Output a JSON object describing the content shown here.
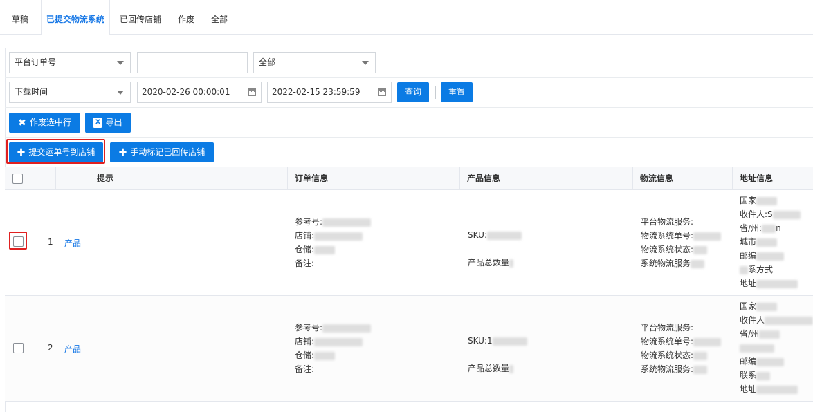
{
  "tabs": [
    {
      "label": "草稿",
      "active": false
    },
    {
      "label": "已提交物流系统",
      "active": true
    },
    {
      "label": "已回传店铺",
      "active": false
    },
    {
      "label": "作废",
      "active": false
    },
    {
      "label": "全部",
      "active": false
    }
  ],
  "filters": {
    "search_field": "平台订单号",
    "search_value": "",
    "status": "全部",
    "time_field": "下载时间",
    "start_time": "2020-02-26 00:00:01",
    "end_time": "2022-02-15 23:59:59",
    "query_label": "查询",
    "reset_label": "重置"
  },
  "actions": {
    "void_selected": "作废选中行",
    "export": "导出",
    "export_icon": "X",
    "submit_tracking": "提交运单号到店铺",
    "mark_returned": "手动标记已回传店铺"
  },
  "columns": [
    "提示",
    "订单信息",
    "产品信息",
    "物流信息",
    "地址信息"
  ],
  "rows": [
    {
      "index": "1",
      "hint": "产品",
      "order": [
        "参考号:",
        "店铺:",
        "仓储:",
        "备注:"
      ],
      "product": [
        "SKU:",
        "产品总数量"
      ],
      "logistics": [
        "平台物流服务:",
        "物流系统单号:",
        "物流系统状态:",
        "系统物流服务"
      ],
      "address": [
        "国家",
        "收件人:S",
        "省/州:",
        "城市",
        "邮编",
        "系方式",
        "地址"
      ],
      "address_tail": {
        "province": "n"
      }
    },
    {
      "index": "2",
      "hint": "产品",
      "order": [
        "参考号:",
        "店铺:",
        "仓储:",
        "备注:"
      ],
      "product": [
        "SKU:1",
        "产品总数量"
      ],
      "logistics": [
        "平台物流服务:",
        "物流系统单号:",
        "物流系统状态:",
        "系统物流服务:"
      ],
      "address": [
        "国家",
        "收件人",
        "省/州",
        "",
        "邮编",
        "联系",
        "地址"
      ]
    }
  ],
  "colors": {
    "accent": "#0b7be4",
    "highlight": "#e02020"
  }
}
